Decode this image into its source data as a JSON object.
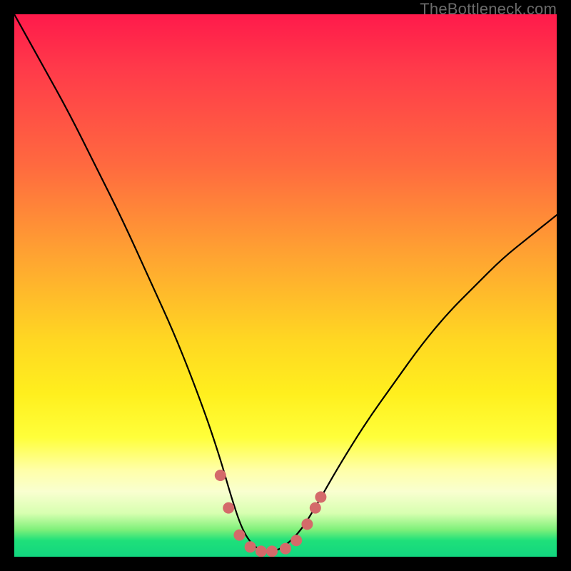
{
  "watermark": "TheBottleneck.com",
  "chart_data": {
    "type": "line",
    "title": "",
    "xlabel": "",
    "ylabel": "",
    "xlim": [
      0,
      1
    ],
    "ylim": [
      0,
      1
    ],
    "series": [
      {
        "name": "bottleneck-curve",
        "x": [
          0.0,
          0.05,
          0.1,
          0.15,
          0.2,
          0.25,
          0.3,
          0.35,
          0.38,
          0.4,
          0.42,
          0.44,
          0.46,
          0.48,
          0.5,
          0.53,
          0.56,
          0.6,
          0.65,
          0.7,
          0.75,
          0.8,
          0.85,
          0.9,
          0.95,
          1.0
        ],
        "values": [
          1.0,
          0.91,
          0.82,
          0.72,
          0.62,
          0.51,
          0.4,
          0.27,
          0.18,
          0.11,
          0.05,
          0.02,
          0.01,
          0.01,
          0.02,
          0.05,
          0.1,
          0.17,
          0.25,
          0.32,
          0.39,
          0.45,
          0.5,
          0.55,
          0.59,
          0.63
        ]
      }
    ],
    "markers": {
      "name": "optimum-markers",
      "color": "#d46a6a",
      "x": [
        0.38,
        0.395,
        0.415,
        0.435,
        0.455,
        0.475,
        0.5,
        0.52,
        0.54,
        0.555,
        0.565
      ],
      "values": [
        0.15,
        0.09,
        0.04,
        0.018,
        0.01,
        0.01,
        0.015,
        0.03,
        0.06,
        0.09,
        0.11
      ]
    }
  }
}
